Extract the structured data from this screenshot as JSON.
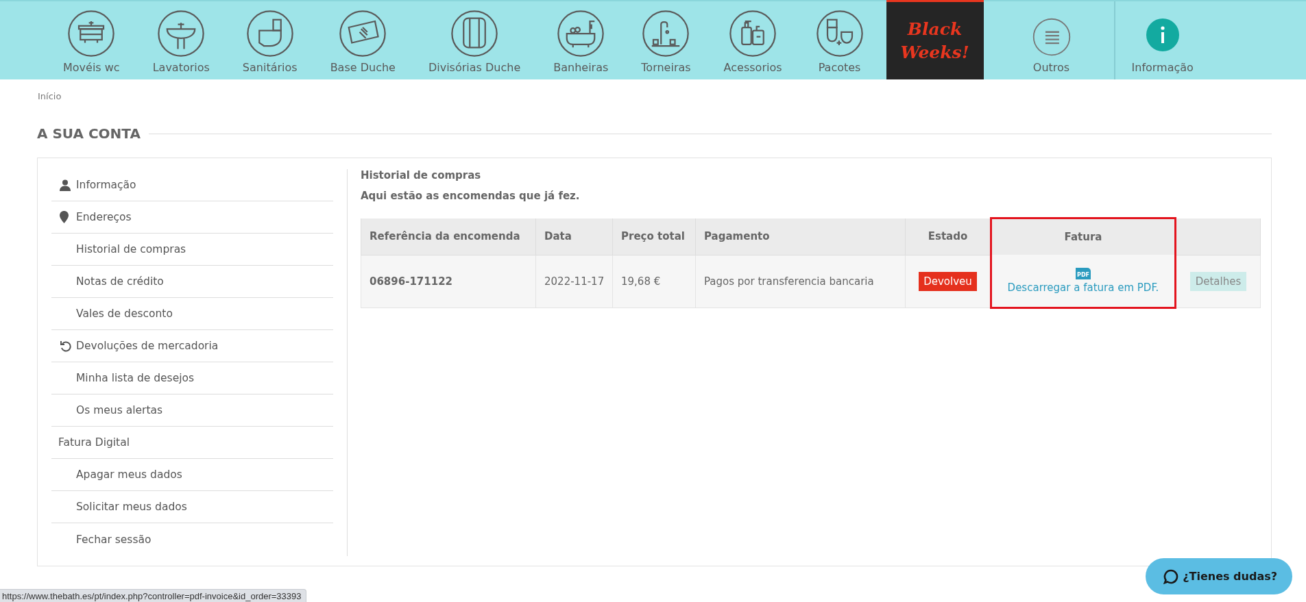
{
  "nav": [
    {
      "kind": "category",
      "label": "Movéis wc"
    },
    {
      "kind": "category",
      "label": "Lavatorios"
    },
    {
      "kind": "category",
      "label": "Sanitários"
    },
    {
      "kind": "category",
      "label": "Base Duche"
    },
    {
      "kind": "category",
      "label": "Divisórias Duche"
    },
    {
      "kind": "category",
      "label": "Banheiras"
    },
    {
      "kind": "category",
      "label": "Torneiras"
    },
    {
      "kind": "category",
      "label": "Acessorios"
    },
    {
      "kind": "category",
      "label": "Pacotes"
    },
    {
      "kind": "promo",
      "label": "Black Weeks!"
    },
    {
      "kind": "more",
      "label": "Outros"
    },
    {
      "kind": "info",
      "label": "Informação"
    }
  ],
  "breadcrumb": [
    "Início"
  ],
  "page_title": "A SUA CONTA",
  "sidebar": {
    "items": [
      {
        "kind": "user",
        "label": "Informação"
      },
      {
        "kind": "address",
        "label": "Endereços"
      },
      {
        "kind": "plain",
        "label": "Historial de compras"
      },
      {
        "kind": "plain",
        "label": "Notas de crédito"
      },
      {
        "kind": "plain",
        "label": "Vales de desconto"
      },
      {
        "kind": "returns",
        "label": "Devoluções de mercadoria"
      },
      {
        "kind": "plain",
        "label": "Minha lista de desejos"
      },
      {
        "kind": "plain",
        "label": "Os meus alertas"
      },
      {
        "kind": "section",
        "label": "Fatura Digital"
      },
      {
        "kind": "plain",
        "label": "Apagar meus dados"
      },
      {
        "kind": "plain",
        "label": "Solicitar meus dados"
      },
      {
        "kind": "plain",
        "label": "Fechar sessão"
      }
    ]
  },
  "content": {
    "title": "Historial de compras",
    "subtitle": "Aqui estão as encomendas que já fez.",
    "table": {
      "columns": [
        {
          "label": "Referência da encomenda",
          "highlighted": false
        },
        {
          "label": "Data",
          "highlighted": false
        },
        {
          "label": "Preço total",
          "highlighted": false
        },
        {
          "label": "Pagamento",
          "highlighted": false
        },
        {
          "label": "Estado",
          "highlighted": false
        },
        {
          "label": "Fatura",
          "highlighted": true
        },
        {
          "highlighted": false
        }
      ],
      "rows": [
        {
          "reference": "06896-171122",
          "date": "2022-11-17",
          "total": "19,68 €",
          "payment": "Pagos por transferencia bancaria",
          "status": "Devolveu",
          "invoice_icon": "PDF",
          "invoice_link": "Descarregar a fatura em PDF.",
          "details": "Detalhes"
        }
      ]
    }
  },
  "chat_button": {
    "label": "¿Tienes dudas?"
  },
  "status_bar": {
    "url": "https://www.thebath.es/pt/index.php?controller=pdf-invoice&id_order=33393"
  }
}
